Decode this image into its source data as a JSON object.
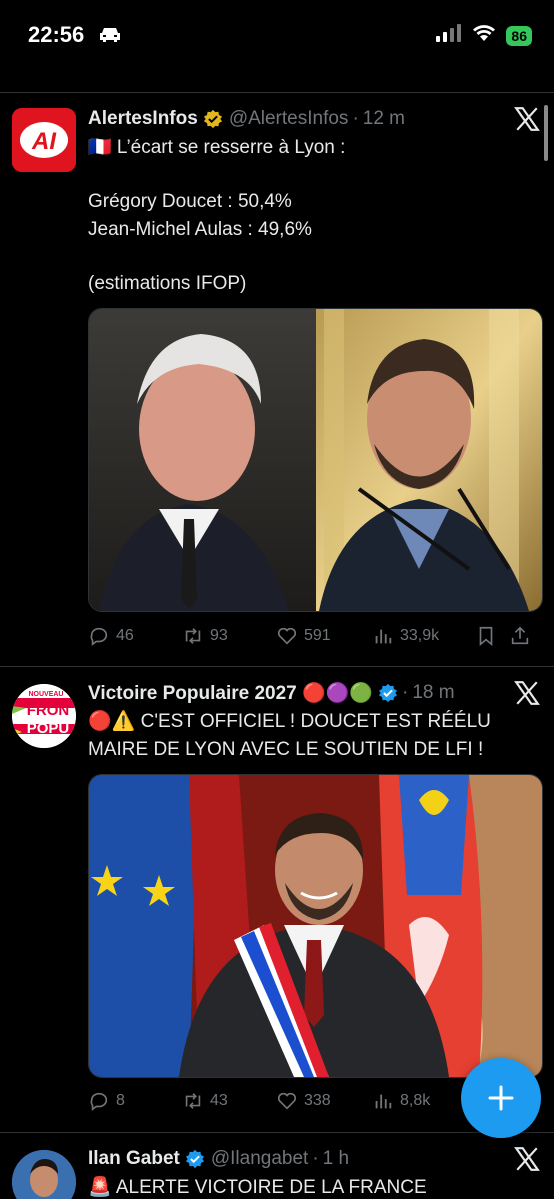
{
  "status_bar": {
    "time": "22:56",
    "battery": "86"
  },
  "tweets": [
    {
      "name": "AlertesInfos",
      "handle": "@AlertesInfos",
      "time": "12 m",
      "avatar_text": "AI",
      "text_line1": "🇫🇷 L’écart se resserre à Lyon :",
      "text_line2": "Grégory Doucet : 50,4%",
      "text_line3": "Jean-Michel Aulas : 49,6%",
      "text_line4": "(estimations IFOP)",
      "stats": {
        "replies": "46",
        "reposts": "93",
        "likes": "591",
        "views": "33,9k"
      }
    },
    {
      "name": "Victoire Populaire 2027 🔴🟣🟢",
      "handle": "",
      "time": "18 m",
      "avatar_lines": [
        "NOUVEAU",
        "FRON",
        "POPU"
      ],
      "text_line1": "🔴⚠️ C'EST OFFICIEL ! DOUCET EST RÉÉLU",
      "text_line2": "MAIRE DE LYON AVEC LE SOUTIEN DE LFI !",
      "stats": {
        "replies": "8",
        "reposts": "43",
        "likes": "338",
        "views": "8,8k"
      }
    },
    {
      "name": "Ilan Gabet",
      "handle": "@Ilangabet",
      "time": "1 h",
      "text_line1": "🚨 ALERTE VICTOIRE DE LA FRANCE"
    }
  ],
  "colors": {
    "accent": "#1d9bf0",
    "verified_gold": "#e2b719",
    "verified_blue": "#1d9bf0",
    "muted": "#71767b"
  },
  "icons": [
    "car-icon",
    "signal-icon",
    "wifi-icon",
    "battery-icon",
    "verified-gold-icon",
    "verified-blue-icon",
    "x-logo-icon",
    "reply-icon",
    "repost-icon",
    "like-icon",
    "views-icon",
    "bookmark-icon",
    "share-icon",
    "plus-icon"
  ]
}
